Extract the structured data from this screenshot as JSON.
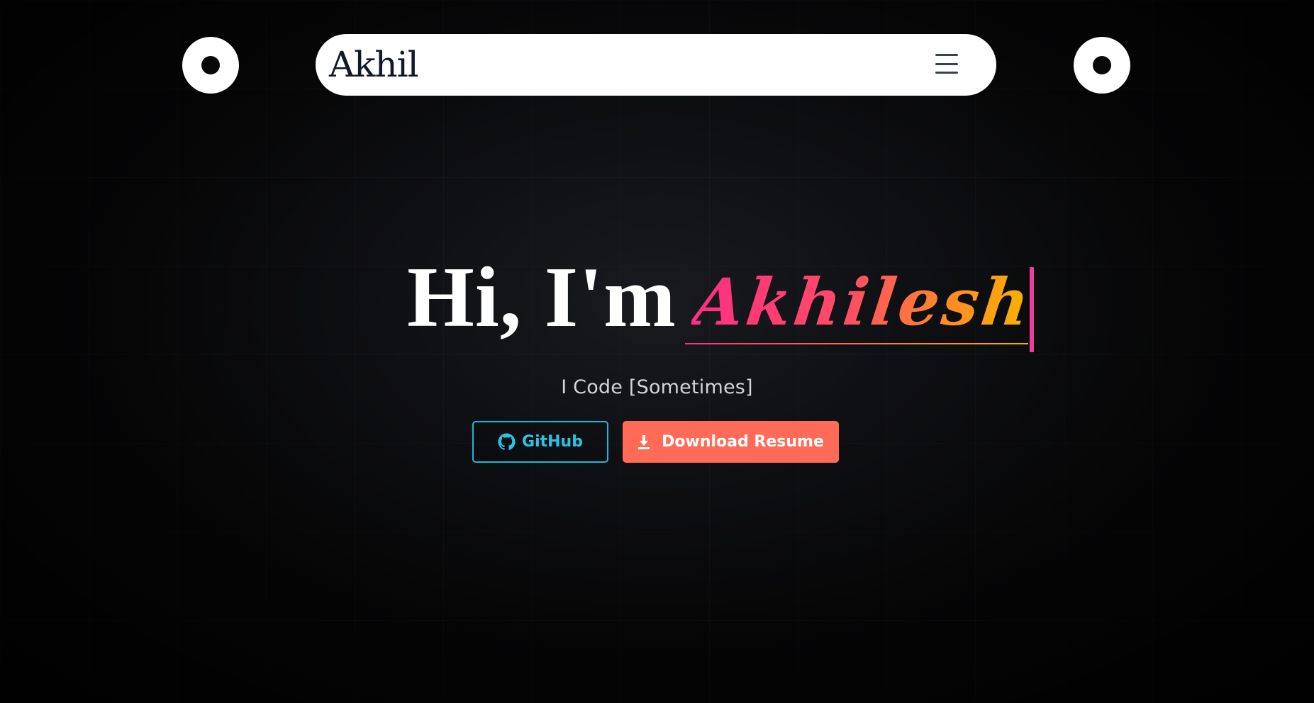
{
  "header": {
    "brand": "Akhil",
    "left_control": "circle-toggle",
    "right_control": "circle-toggle",
    "menu_icon": "menu-icon"
  },
  "hero": {
    "greeting": "Hi, I'm",
    "name": "Akhilesh",
    "tagline": "I Code [Sometimes]"
  },
  "actions": {
    "github_label": "GitHub",
    "github_icon": "github-icon",
    "resume_label": "Download Resume",
    "resume_icon": "download-icon"
  },
  "theme": {
    "background": "#050505",
    "nav_background": "#ffffff",
    "github_accent": "#1fb6d8",
    "resume_accent": "#ff6b56",
    "name_gradient": [
      "#ff2e84",
      "#ff4d65",
      "#ff8f22",
      "#f5b400"
    ]
  }
}
